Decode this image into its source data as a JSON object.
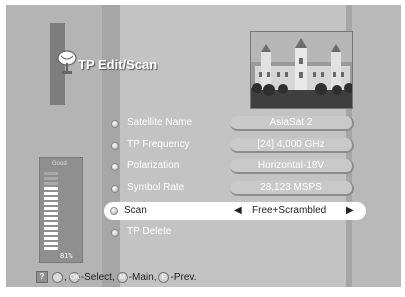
{
  "menu": {
    "title": "TP Edit/Scan"
  },
  "fields": [
    {
      "label": "Satellite Name",
      "value": "AsiaSat 2"
    },
    {
      "label": "TP Frequency",
      "value": "[24] 4,000 GHz"
    },
    {
      "label": "Polarization",
      "value": "Horizontal-18V"
    },
    {
      "label": "Symbol Rate",
      "value": "28,123 MSPS"
    },
    {
      "label": "Scan",
      "value": "Free+Scrambled",
      "selected": true
    },
    {
      "label": "TP Delete"
    }
  ],
  "signal": {
    "label": "Good",
    "level_percent": 81,
    "percent_text": "81%"
  },
  "footer": {
    "help_key": "?",
    "info_key": "i",
    "ok_key": "OK",
    "menu_key": "M",
    "exit_key": "E",
    "select_text": "-Select,",
    "main_text": "-Main,",
    "prev_text": "-Prev.",
    "comma": ","
  },
  "icons": {
    "title": "satellite-dish-icon",
    "left_arrow": "◀",
    "right_arrow": "▶"
  },
  "colors": {
    "panel": "#a6a6a6",
    "highlight": "#ffffff",
    "text": "#ffffff"
  }
}
